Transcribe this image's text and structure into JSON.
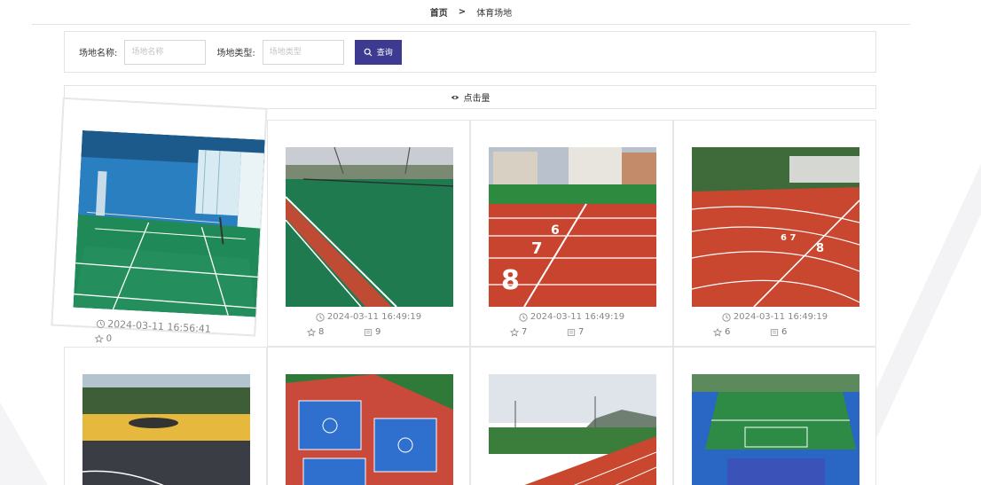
{
  "breadcrumb": {
    "home": "首页",
    "separator": ">",
    "current": "体育场地"
  },
  "search": {
    "name_label": "场地名称:",
    "name_placeholder": "场地名称",
    "type_label": "场地类型:",
    "type_placeholder": "场地类型",
    "button_label": "查询"
  },
  "sort": {
    "label": "点击量",
    "icon": "eye-icon"
  },
  "cards": [
    {
      "time": "2024-03-11 16:56:41",
      "likes": "0",
      "replies": ""
    },
    {
      "time": "2024-03-11 16:49:19",
      "likes": "8",
      "replies": "9"
    },
    {
      "time": "2024-03-11 16:49:19",
      "likes": "7",
      "replies": "7"
    },
    {
      "time": "2024-03-11 16:49:19",
      "likes": "6",
      "replies": "6"
    },
    {
      "time": "",
      "likes": "",
      "replies": ""
    },
    {
      "time": "",
      "likes": "",
      "replies": ""
    },
    {
      "time": "",
      "likes": "",
      "replies": ""
    },
    {
      "time": "",
      "likes": "",
      "replies": ""
    }
  ],
  "colors": {
    "accent": "#3d3a91",
    "border": "#e3e3e3",
    "muted_text": "#888888"
  }
}
